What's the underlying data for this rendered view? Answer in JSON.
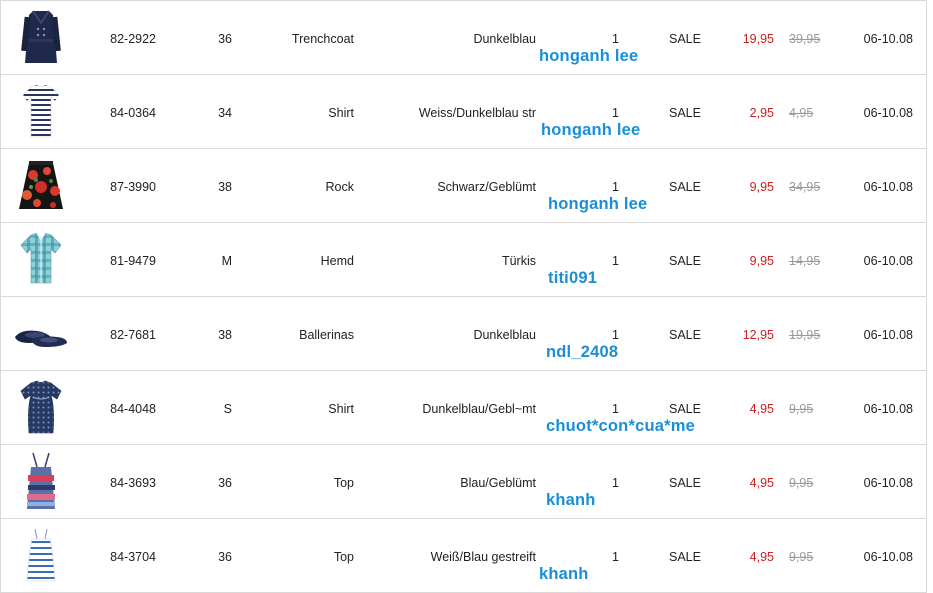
{
  "rows": [
    {
      "image": "trenchcoat-product-icon",
      "article": "82-2922",
      "size": "36",
      "name": "Trenchcoat",
      "color": "Dunkelblau",
      "qty": "1",
      "status": "SALE",
      "price": "19,95",
      "old_price": "39,95",
      "date": "06-10.08",
      "user": "honganh lee"
    },
    {
      "image": "striped-shirt-product-icon",
      "article": "84-0364",
      "size": "34",
      "name": "Shirt",
      "color": "Weiss/Dunkelblau str",
      "qty": "1",
      "status": "SALE",
      "price": "2,95",
      "old_price": "4,95",
      "date": "06-10.08",
      "user": "honganh lee"
    },
    {
      "image": "floral-skirt-product-icon",
      "article": "87-3990",
      "size": "38",
      "name": "Rock",
      "color": "Schwarz/Geblümt",
      "qty": "1",
      "status": "SALE",
      "price": "9,95",
      "old_price": "34,95",
      "date": "06-10.08",
      "user": "honganh lee"
    },
    {
      "image": "checked-shirt-product-icon",
      "article": "81-9479",
      "size": "M",
      "name": "Hemd",
      "color": "Türkis",
      "qty": "1",
      "status": "SALE",
      "price": "9,95",
      "old_price": "14,95",
      "date": "06-10.08",
      "user": "titi091"
    },
    {
      "image": "ballerina-shoes-product-icon",
      "article": "82-7681",
      "size": "38",
      "name": "Ballerinas",
      "color": "Dunkelblau",
      "qty": "1",
      "status": "SALE",
      "price": "12,95",
      "old_price": "19,95",
      "date": "06-10.08",
      "user": "ndl_2408"
    },
    {
      "image": "patterned-blouse-product-icon",
      "article": "84-4048",
      "size": "S",
      "name": "Shirt",
      "color": "Dunkelblau/Gebl~mt",
      "qty": "1",
      "status": "SALE",
      "price": "4,95",
      "old_price": "9,95",
      "date": "06-10.08",
      "user": "chuot*con*cua*me"
    },
    {
      "image": "printed-top-product-icon",
      "article": "84-3693",
      "size": "36",
      "name": "Top",
      "color": "Blau/Geblümt",
      "qty": "1",
      "status": "SALE",
      "price": "4,95",
      "old_price": "9,95",
      "date": "06-10.08",
      "user": "khanh"
    },
    {
      "image": "striped-top-product-icon",
      "article": "84-3704",
      "size": "36",
      "name": "Top",
      "color": "Weiß/Blau gestreift",
      "qty": "1",
      "status": "SALE",
      "price": "4,95",
      "old_price": "9,95",
      "date": "06-10.08",
      "user": "khanh"
    }
  ],
  "colors": {
    "sale_price": "#cc1f1f",
    "old_price": "#999999",
    "user_label": "#1a8fd6",
    "divider": "#d9d9d9"
  }
}
